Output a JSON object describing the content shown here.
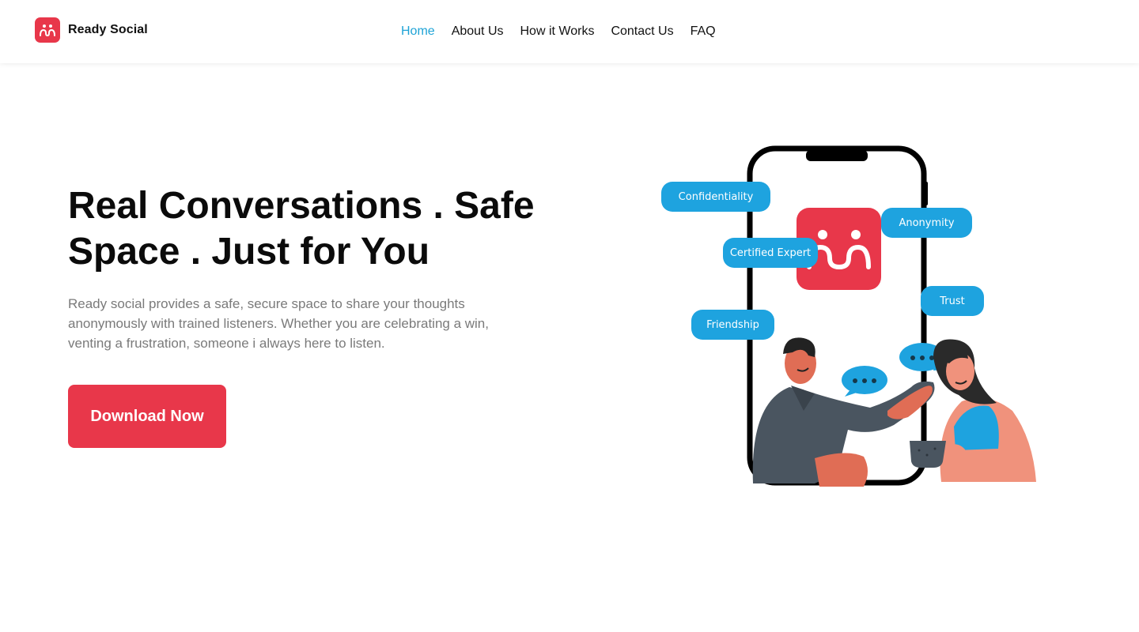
{
  "header": {
    "brand_name": "Ready Social",
    "nav": [
      {
        "label": "Home",
        "active": true
      },
      {
        "label": "About Us",
        "active": false
      },
      {
        "label": "How it Works",
        "active": false
      },
      {
        "label": "Contact Us",
        "active": false
      },
      {
        "label": "FAQ",
        "active": false
      }
    ]
  },
  "hero": {
    "title_line1": "Real Conversations . Safe",
    "title_line2": "Space . Just for You",
    "description": "Ready social provides a safe, secure space to share your thoughts anonymously with trained listeners. Whether you are celebrating a win, venting a frustration, someone i always here to listen.",
    "cta_label": "Download Now"
  },
  "illustration": {
    "tags": [
      "Confidentiality",
      "Anonymity",
      "Certified Expert",
      "Trust",
      "Friendship"
    ]
  },
  "colors": {
    "brand_red": "#e8374a",
    "accent_blue": "#1ea3df",
    "active_nav": "#1ea3d6"
  }
}
